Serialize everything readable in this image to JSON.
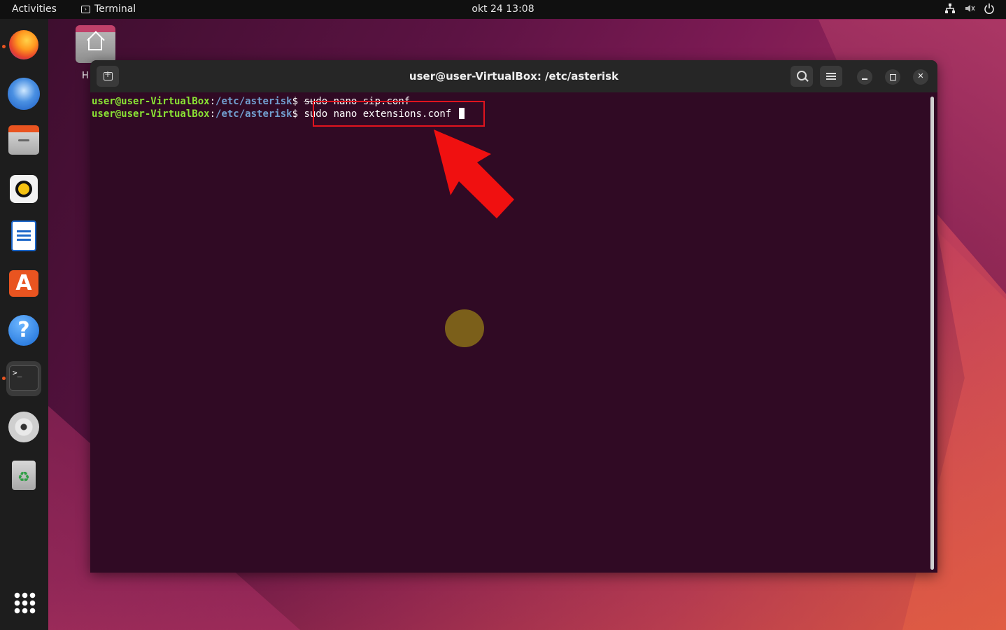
{
  "topbar": {
    "activities": "Activities",
    "app_name": "Terminal",
    "clock": "okt 24  13:08",
    "tray_icons": [
      "network-icon",
      "volume-muted-icon",
      "power-icon"
    ]
  },
  "dock": {
    "items": [
      {
        "name": "firefox",
        "running": true
      },
      {
        "name": "thunderbird",
        "running": false
      },
      {
        "name": "files",
        "running": false
      },
      {
        "name": "rhythmbox",
        "running": false
      },
      {
        "name": "libreoffice-writer",
        "running": false
      },
      {
        "name": "ubuntu-software",
        "running": false
      },
      {
        "name": "help",
        "running": false
      },
      {
        "name": "terminal",
        "running": true,
        "active": true
      },
      {
        "name": "dvd-drive",
        "running": false
      },
      {
        "name": "trash",
        "running": false
      }
    ],
    "show_apps": "show-applications"
  },
  "desktop": {
    "home_label": "H"
  },
  "window": {
    "title": "user@user-VirtualBox: /etc/asterisk",
    "lines": [
      {
        "user": "user@user-VirtualBox",
        "sep": ":",
        "path": "/etc/asterisk",
        "prompt": "$ ",
        "command": "sudo nano sip.conf",
        "struck": true
      },
      {
        "user": "user@user-VirtualBox",
        "sep": ":",
        "path": "/etc/asterisk",
        "prompt": "$ ",
        "command": "sudo nano extensions.conf ",
        "struck": false
      }
    ]
  },
  "colors": {
    "terminal_bg": "#300a24",
    "accent": "#e95420",
    "highlight": "#e0141e"
  }
}
